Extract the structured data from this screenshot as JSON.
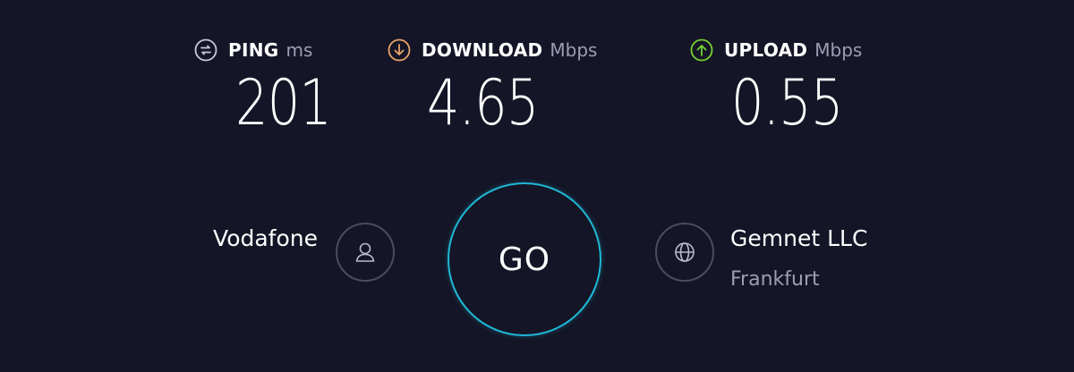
{
  "metrics": {
    "ping": {
      "label": "PING",
      "unit": "ms",
      "value": "201",
      "icon": "ping-icon",
      "color": "#c7c9d9"
    },
    "download": {
      "label": "DOWNLOAD",
      "unit": "Mbps",
      "value": "4.65",
      "icon": "download-arrow-icon",
      "color": "#e8a36c"
    },
    "upload": {
      "label": "UPLOAD",
      "unit": "Mbps",
      "value": "0.55",
      "icon": "upload-arrow-icon",
      "color": "#76d02f"
    }
  },
  "go_button": {
    "label": "GO",
    "ring_color": "#1fb8d6"
  },
  "provider": {
    "name": "Vodafone",
    "icon": "user-icon"
  },
  "server": {
    "name": "Gemnet LLC",
    "location": "Frankfurt",
    "icon": "globe-icon"
  },
  "colors": {
    "background": "#141526",
    "muted_text": "#9b9eb6",
    "icon_ring": "#4a4c63"
  }
}
